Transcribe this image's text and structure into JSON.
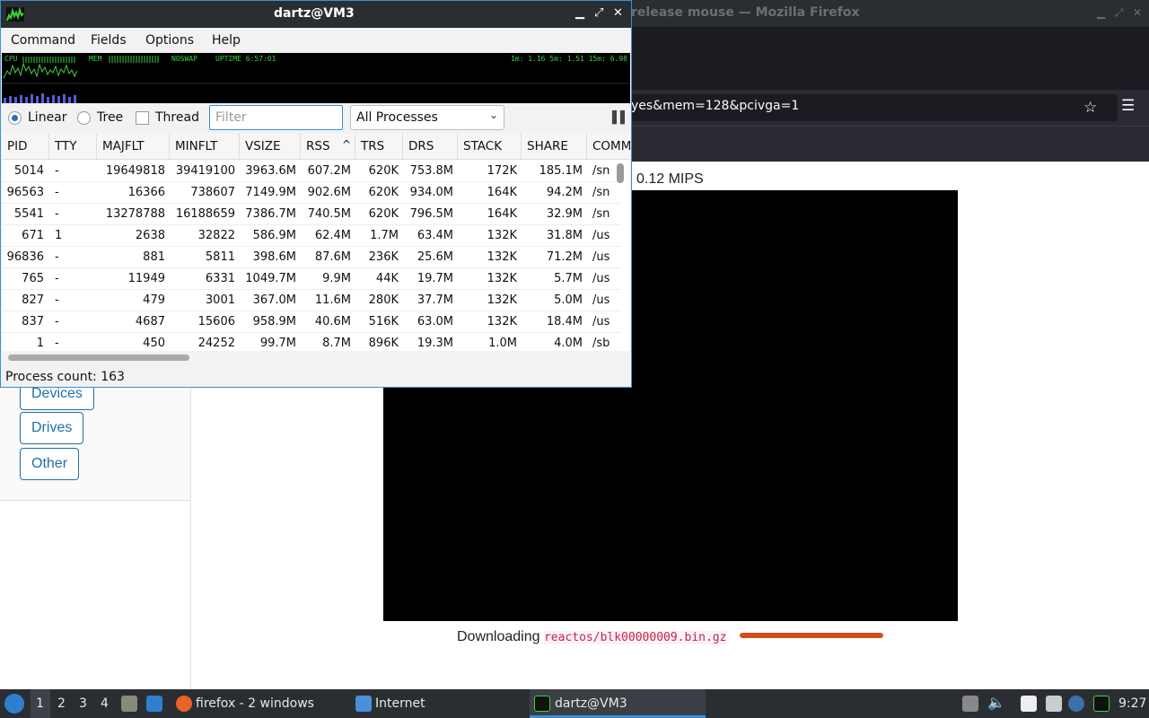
{
  "firefox": {
    "title": "release mouse — Mozilla Firefox",
    "url": "yes&mem=128&pcivga=1",
    "mips": "0.12 MIPS",
    "sidebar_buttons": [
      "Devices",
      "Drives",
      "Other"
    ],
    "download_label": "Downloading",
    "download_file": "reactos/blk00000009.bin.gz",
    "download_progress_color": "#d0501c"
  },
  "qps": {
    "title": "dartz@VM3",
    "menu": [
      "Command",
      "Fields",
      "Options",
      "Help"
    ],
    "graph": {
      "cpu_label": "CPU",
      "mem_label": "MEM",
      "swap_label": "NOSWAP",
      "uptime_label": "UPTIME 6:57:01",
      "load_label": "1m: 1.16 5m: 1.51 15m: 6.98"
    },
    "toolbar": {
      "linear_label": "Linear",
      "tree_label": "Tree",
      "thread_label": "Thread",
      "filter_placeholder": "Filter",
      "process_filter": "All Processes"
    },
    "columns": [
      "PID",
      "TTY",
      "MAJFLT",
      "MINFLT",
      "VSIZE",
      "RSS",
      "TRS",
      "DRS",
      "STACK",
      "SHARE",
      "COMM"
    ],
    "sort_column": "RSS",
    "rows": [
      [
        "5014",
        "-",
        "19649818",
        "39419100",
        "3963.6M",
        "607.2M",
        "620K",
        "753.8M",
        "172K",
        "185.1M",
        "/sn"
      ],
      [
        "96563",
        "-",
        "16366",
        "738607",
        "7149.9M",
        "902.6M",
        "620K",
        "934.0M",
        "164K",
        "94.2M",
        "/sn"
      ],
      [
        "5541",
        "-",
        "13278788",
        "16188659",
        "7386.7M",
        "740.5M",
        "620K",
        "796.5M",
        "164K",
        "32.9M",
        "/sn"
      ],
      [
        "671",
        "1",
        "2638",
        "32822",
        "586.9M",
        "62.4M",
        "1.7M",
        "63.4M",
        "132K",
        "31.8M",
        "/us"
      ],
      [
        "96836",
        "-",
        "881",
        "5811",
        "398.6M",
        "87.6M",
        "236K",
        "25.6M",
        "132K",
        "71.2M",
        "/us"
      ],
      [
        "765",
        "-",
        "11949",
        "6331",
        "1049.7M",
        "9.9M",
        "44K",
        "19.7M",
        "132K",
        "5.7M",
        "/us"
      ],
      [
        "827",
        "-",
        "479",
        "3001",
        "367.0M",
        "11.6M",
        "280K",
        "37.7M",
        "132K",
        "5.0M",
        "/us"
      ],
      [
        "837",
        "-",
        "4687",
        "15606",
        "958.9M",
        "40.6M",
        "516K",
        "63.0M",
        "132K",
        "18.4M",
        "/us"
      ],
      [
        "1",
        "-",
        "450",
        "24252",
        "99.7M",
        "8.7M",
        "896K",
        "19.3M",
        "1.0M",
        "4.0M",
        "/sb"
      ]
    ],
    "status": "Process count: 163"
  },
  "taskbar": {
    "workspaces": [
      "1",
      "2",
      "3",
      "4"
    ],
    "firefox_task": "firefox - 2 windows",
    "files_task": "Internet",
    "qps_task": "dartz@VM3",
    "clock": "9:27"
  }
}
